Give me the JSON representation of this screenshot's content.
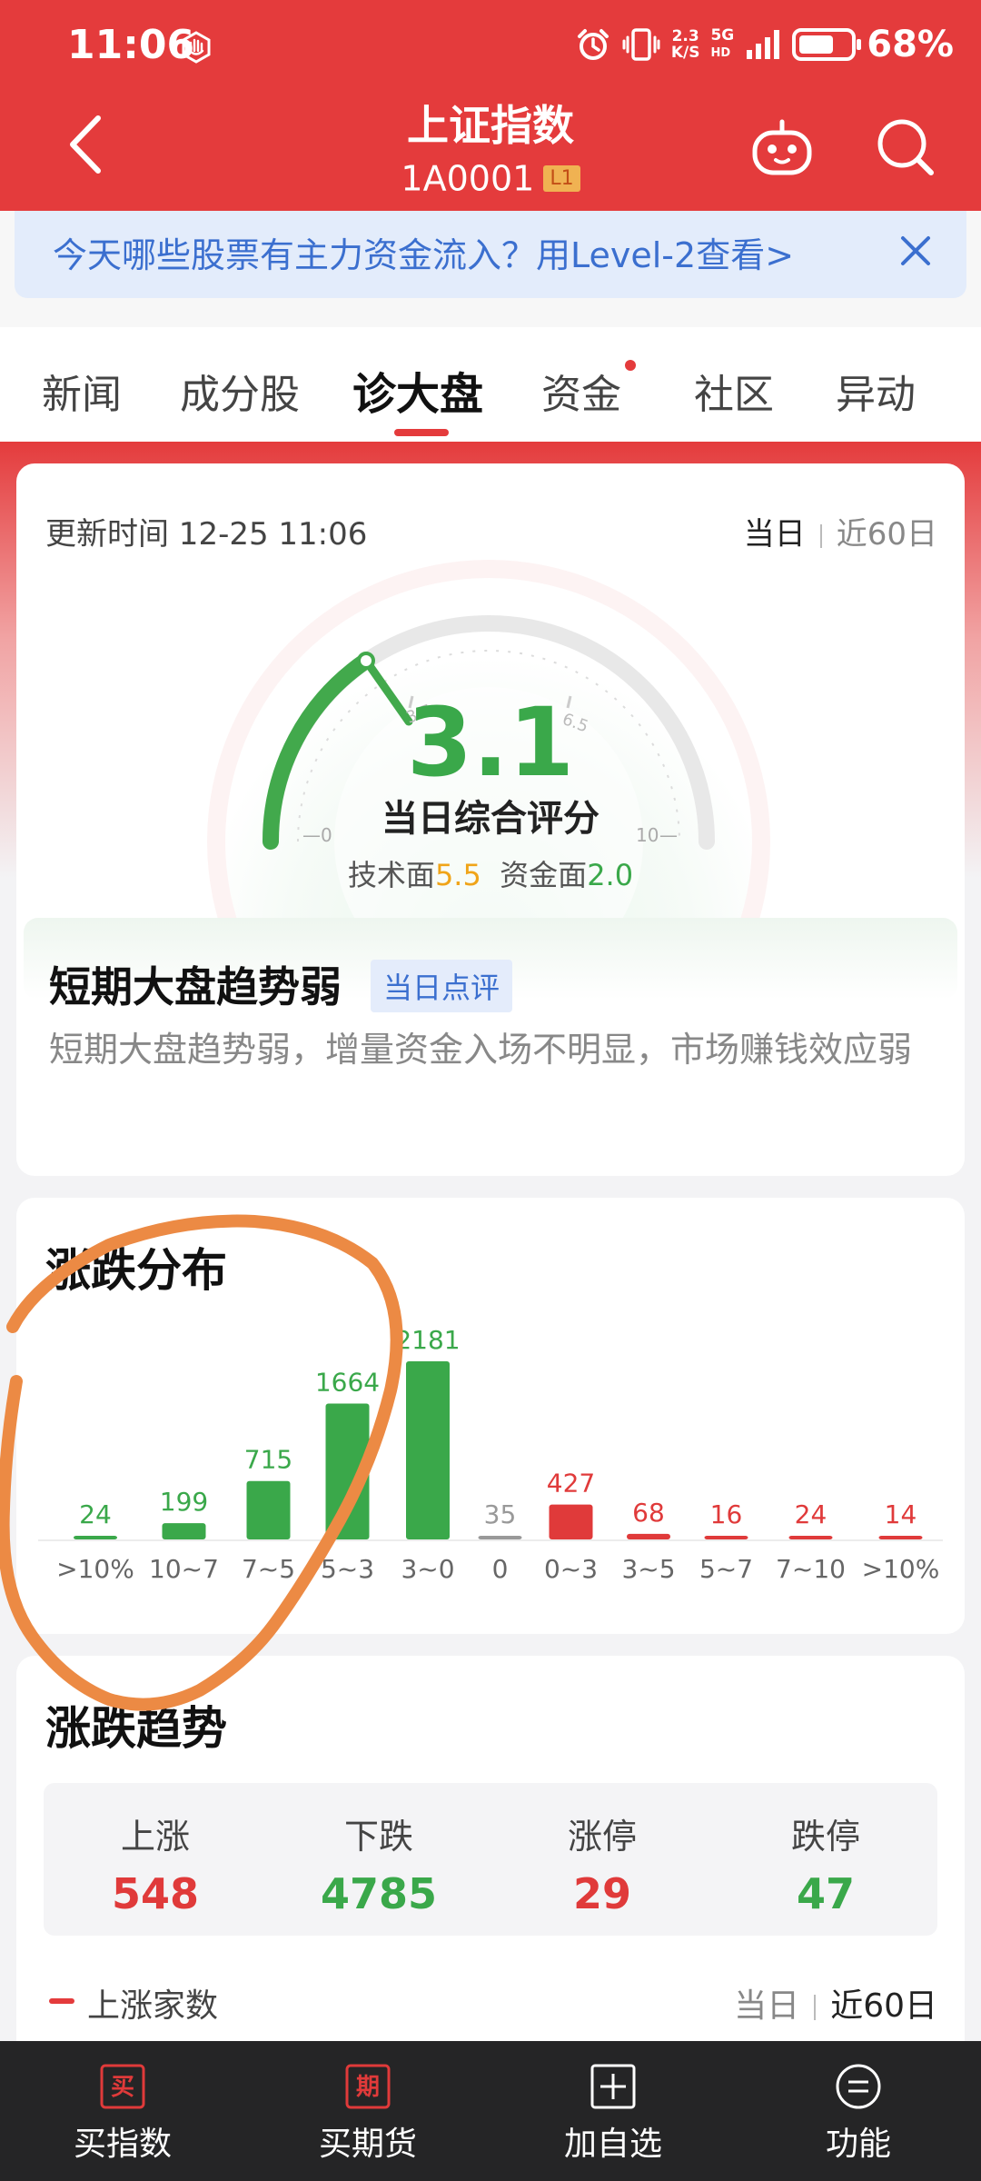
{
  "status_bar": {
    "time": "11:06",
    "net_speed_top": "2.3",
    "net_speed_bottom": "K/S",
    "network_top": "5G",
    "network_bottom": "HD",
    "battery": "68%",
    "battery_level": 0.68
  },
  "header": {
    "title": "上证指数",
    "code": "1A0001",
    "badge": "L1"
  },
  "banner": {
    "text": "今天哪些股票有主力资金流入？用Level-2查看>"
  },
  "tabs": [
    "新闻",
    "成分股",
    "诊大盘",
    "资金",
    "社区",
    "异动"
  ],
  "active_tab": "诊大盘",
  "score_card": {
    "update_label": "更新时间 12-25 11:06",
    "period_today": "当日",
    "period_60": "近60日",
    "score": "3.1",
    "score_label": "当日综合评分",
    "tech_label": "技术面",
    "tech_value": "5.5",
    "fund_label": "资金面",
    "fund_value": "2.0",
    "gauge_ticks": [
      "0",
      "3.5",
      "6.5",
      "10"
    ],
    "trend_title": "短期大盘趋势弱",
    "trend_tag": "当日点评",
    "trend_desc": "短期大盘趋势弱，增量资金入场不明显，市场赚钱效应弱"
  },
  "distribution": {
    "title": "涨跌分布"
  },
  "chart_data": {
    "type": "bar",
    "categories": [
      ">10%",
      "10~7",
      "7~5",
      "5~3",
      "3~0",
      "0",
      "0~3",
      "3~5",
      "5~7",
      "7~10",
      ">10%"
    ],
    "values": [
      24,
      199,
      715,
      1664,
      2181,
      35,
      427,
      68,
      16,
      24,
      14
    ],
    "colors": [
      "#3aa84a",
      "#3aa84a",
      "#3aa84a",
      "#3aa84a",
      "#3aa84a",
      "#999999",
      "#e03a3a",
      "#e03a3a",
      "#e03a3a",
      "#e03a3a",
      "#e03a3a"
    ]
  },
  "trend": {
    "title": "涨跌趋势",
    "stats": [
      {
        "label": "上涨",
        "value": "548",
        "color": "red"
      },
      {
        "label": "下跌",
        "value": "4785",
        "color": "green"
      },
      {
        "label": "涨停",
        "value": "29",
        "color": "red"
      },
      {
        "label": "跌停",
        "value": "47",
        "color": "green"
      }
    ],
    "legend": "上涨家数",
    "period_today": "当日",
    "period_60": "近60日"
  },
  "bottom_nav": [
    {
      "label": "买指数",
      "icon_text": "买"
    },
    {
      "label": "买期货",
      "icon_text": "期"
    },
    {
      "label": "加自选"
    },
    {
      "label": "功能"
    }
  ]
}
